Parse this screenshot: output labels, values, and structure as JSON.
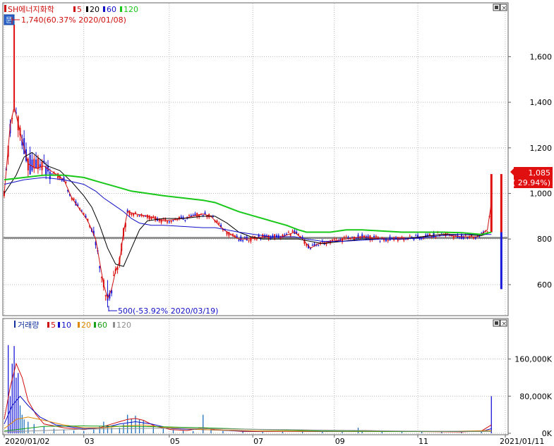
{
  "chart_data": [
    {
      "type": "candlestick",
      "panel": "price",
      "title": "SH에너지화학",
      "legend": [
        {
          "label": "SH에너지화학",
          "color": "#d01010"
        },
        {
          "label": "5",
          "color": "#d01010"
        },
        {
          "label": "20",
          "color": "#000000"
        },
        {
          "label": "60",
          "color": "#1010c8"
        },
        {
          "label": "120",
          "color": "#18c818"
        }
      ],
      "y_ticks": [
        "1,600",
        "1,400",
        "1,200",
        "1,000",
        "800",
        "600"
      ],
      "y_tick_values": [
        1600,
        1400,
        1200,
        1000,
        800,
        600
      ],
      "ylim": [
        470,
        1830
      ],
      "reference_line": 805,
      "last_price": {
        "value": "1,085",
        "change": "( 29.94%)"
      },
      "annotation_high": "1,740(60.37% 2020/01/08)",
      "annotation_low": "500(-53.92% 2020/03/19)",
      "ma_points": {
        "ma5": [
          [
            0,
            1000
          ],
          [
            3,
            1300
          ],
          [
            5,
            1380
          ],
          [
            8,
            1270
          ],
          [
            12,
            1130
          ],
          [
            16,
            1110
          ],
          [
            20,
            1120
          ],
          [
            25,
            1090
          ],
          [
            30,
            1060
          ],
          [
            34,
            980
          ],
          [
            38,
            930
          ],
          [
            42,
            880
          ],
          [
            46,
            800
          ],
          [
            48,
            700
          ],
          [
            50,
            600
          ],
          [
            52,
            540
          ],
          [
            54,
            580
          ],
          [
            56,
            660
          ],
          [
            58,
            700
          ],
          [
            60,
            830
          ],
          [
            62,
            920
          ],
          [
            66,
            910
          ],
          [
            72,
            900
          ],
          [
            80,
            880
          ],
          [
            90,
            890
          ],
          [
            100,
            910
          ],
          [
            104,
            900
          ],
          [
            108,
            860
          ],
          [
            112,
            830
          ],
          [
            118,
            800
          ],
          [
            124,
            800
          ],
          [
            130,
            810
          ],
          [
            140,
            810
          ],
          [
            146,
            830
          ],
          [
            150,
            800
          ],
          [
            154,
            760
          ],
          [
            158,
            780
          ],
          [
            165,
            790
          ],
          [
            172,
            800
          ],
          [
            180,
            810
          ],
          [
            190,
            800
          ],
          [
            200,
            800
          ],
          [
            210,
            810
          ],
          [
            220,
            820
          ],
          [
            230,
            810
          ],
          [
            238,
            810
          ],
          [
            243,
            840
          ],
          [
            245,
            960
          ]
        ],
        "ma20": [
          [
            0,
            1000
          ],
          [
            6,
            1080
          ],
          [
            10,
            1160
          ],
          [
            14,
            1180
          ],
          [
            18,
            1150
          ],
          [
            22,
            1120
          ],
          [
            28,
            1100
          ],
          [
            34,
            1050
          ],
          [
            40,
            990
          ],
          [
            44,
            940
          ],
          [
            48,
            860
          ],
          [
            52,
            760
          ],
          [
            56,
            690
          ],
          [
            60,
            680
          ],
          [
            64,
            760
          ],
          [
            68,
            840
          ],
          [
            72,
            880
          ],
          [
            80,
            890
          ],
          [
            90,
            890
          ],
          [
            100,
            900
          ],
          [
            106,
            900
          ],
          [
            112,
            870
          ],
          [
            118,
            830
          ],
          [
            124,
            810
          ],
          [
            130,
            800
          ],
          [
            140,
            800
          ],
          [
            148,
            800
          ],
          [
            154,
            790
          ],
          [
            160,
            780
          ],
          [
            170,
            790
          ],
          [
            180,
            800
          ],
          [
            190,
            800
          ],
          [
            200,
            800
          ],
          [
            210,
            810
          ],
          [
            220,
            820
          ],
          [
            230,
            820
          ],
          [
            240,
            815
          ],
          [
            245,
            830
          ]
        ],
        "ma60": [
          [
            0,
            1040
          ],
          [
            10,
            1060
          ],
          [
            20,
            1070
          ],
          [
            30,
            1060
          ],
          [
            40,
            1040
          ],
          [
            46,
            1010
          ],
          [
            50,
            980
          ],
          [
            55,
            950
          ],
          [
            60,
            920
          ],
          [
            64,
            890
          ],
          [
            68,
            870
          ],
          [
            74,
            860
          ],
          [
            80,
            860
          ],
          [
            90,
            855
          ],
          [
            100,
            850
          ],
          [
            106,
            850
          ],
          [
            112,
            840
          ],
          [
            118,
            830
          ],
          [
            126,
            820
          ],
          [
            134,
            810
          ],
          [
            146,
            810
          ],
          [
            152,
            800
          ],
          [
            160,
            790
          ],
          [
            170,
            790
          ],
          [
            180,
            795
          ],
          [
            190,
            800
          ],
          [
            200,
            800
          ],
          [
            210,
            805
          ],
          [
            220,
            815
          ],
          [
            230,
            820
          ],
          [
            240,
            820
          ],
          [
            245,
            820
          ]
        ],
        "ma120": [
          [
            0,
            1060
          ],
          [
            10,
            1070
          ],
          [
            20,
            1080
          ],
          [
            30,
            1080
          ],
          [
            40,
            1070
          ],
          [
            48,
            1050
          ],
          [
            56,
            1030
          ],
          [
            64,
            1010
          ],
          [
            72,
            1000
          ],
          [
            80,
            990
          ],
          [
            90,
            980
          ],
          [
            100,
            970
          ],
          [
            106,
            960
          ],
          [
            112,
            940
          ],
          [
            118,
            920
          ],
          [
            126,
            900
          ],
          [
            134,
            880
          ],
          [
            142,
            860
          ],
          [
            148,
            840
          ],
          [
            152,
            830
          ],
          [
            158,
            830
          ],
          [
            164,
            830
          ],
          [
            172,
            840
          ],
          [
            180,
            840
          ],
          [
            190,
            835
          ],
          [
            200,
            830
          ],
          [
            210,
            830
          ],
          [
            220,
            830
          ],
          [
            230,
            828
          ],
          [
            240,
            820
          ],
          [
            245,
            830
          ]
        ]
      }
    },
    {
      "type": "bar",
      "panel": "volume",
      "title": "거래량",
      "legend": [
        {
          "label": "거래량",
          "color": "#1030a0"
        },
        {
          "label": "5",
          "color": "#d01010"
        },
        {
          "label": "10",
          "color": "#1010c8"
        },
        {
          "label": "20",
          "color": "#e08800"
        },
        {
          "label": "60",
          "color": "#18a018"
        },
        {
          "label": "120",
          "color": "#909090"
        }
      ],
      "y_ticks": [
        "160,000K",
        "80,000K",
        "0K"
      ],
      "y_tick_values": [
        160000,
        80000,
        0
      ],
      "ylim": [
        0,
        220000
      ],
      "x_labels": [
        "2020/01/02",
        "03",
        "05",
        "07",
        "09",
        "11",
        "2021/01/11"
      ],
      "x_label_positions_idx": [
        0,
        40,
        83,
        125,
        166,
        208,
        252
      ],
      "volumes": [
        [
          2,
          190000
        ],
        [
          3,
          80000
        ],
        [
          4,
          150000
        ],
        [
          5,
          188000
        ],
        [
          6,
          120000
        ],
        [
          7,
          130000
        ],
        [
          8,
          60000
        ],
        [
          9,
          40000
        ],
        [
          10,
          30000
        ],
        [
          12,
          25000
        ],
        [
          15,
          20000
        ],
        [
          20,
          15000
        ],
        [
          25,
          10000
        ],
        [
          30,
          8000
        ],
        [
          35,
          6000
        ],
        [
          40,
          5000
        ],
        [
          45,
          8000
        ],
        [
          48,
          15000
        ],
        [
          50,
          25000
        ],
        [
          52,
          18000
        ],
        [
          54,
          12000
        ],
        [
          58,
          12000
        ],
        [
          60,
          20000
        ],
        [
          62,
          40000
        ],
        [
          64,
          32000
        ],
        [
          66,
          38000
        ],
        [
          68,
          30000
        ],
        [
          70,
          28000
        ],
        [
          75,
          15000
        ],
        [
          80,
          10000
        ],
        [
          85,
          8000
        ],
        [
          90,
          6000
        ],
        [
          95,
          5000
        ],
        [
          100,
          40000
        ],
        [
          104,
          8000
        ],
        [
          110,
          5000
        ],
        [
          120,
          4000
        ],
        [
          130,
          3000
        ],
        [
          140,
          4000
        ],
        [
          150,
          3000
        ],
        [
          160,
          3000
        ],
        [
          170,
          4000
        ],
        [
          178,
          12000
        ],
        [
          180,
          5000
        ],
        [
          190,
          4000
        ],
        [
          200,
          5000
        ],
        [
          210,
          4000
        ],
        [
          220,
          3000
        ],
        [
          230,
          3000
        ],
        [
          240,
          4000
        ],
        [
          245,
          80000
        ]
      ],
      "ma_points": {
        "ma5": [
          [
            0,
            30000
          ],
          [
            3,
            100000
          ],
          [
            6,
            150000
          ],
          [
            9,
            120000
          ],
          [
            12,
            70000
          ],
          [
            16,
            40000
          ],
          [
            20,
            20000
          ],
          [
            30,
            12000
          ],
          [
            40,
            8000
          ],
          [
            48,
            12000
          ],
          [
            54,
            20000
          ],
          [
            58,
            25000
          ],
          [
            62,
            30000
          ],
          [
            66,
            32000
          ],
          [
            70,
            28000
          ],
          [
            76,
            15000
          ],
          [
            84,
            8000
          ],
          [
            92,
            6000
          ],
          [
            100,
            12000
          ],
          [
            106,
            8000
          ],
          [
            120,
            4000
          ],
          [
            140,
            4000
          ],
          [
            170,
            4000
          ],
          [
            180,
            6000
          ],
          [
            200,
            4000
          ],
          [
            230,
            3000
          ],
          [
            240,
            5000
          ],
          [
            245,
            18000
          ]
        ],
        "ma10": [
          [
            0,
            20000
          ],
          [
            4,
            60000
          ],
          [
            8,
            80000
          ],
          [
            12,
            60000
          ],
          [
            18,
            35000
          ],
          [
            26,
            18000
          ],
          [
            40,
            10000
          ],
          [
            50,
            12000
          ],
          [
            58,
            20000
          ],
          [
            66,
            25000
          ],
          [
            74,
            20000
          ],
          [
            84,
            10000
          ],
          [
            100,
            8000
          ],
          [
            120,
            5000
          ],
          [
            160,
            4000
          ],
          [
            200,
            4000
          ],
          [
            240,
            4000
          ],
          [
            245,
            10000
          ]
        ],
        "ma20": [
          [
            0,
            10000
          ],
          [
            6,
            30000
          ],
          [
            12,
            35000
          ],
          [
            20,
            28000
          ],
          [
            30,
            18000
          ],
          [
            40,
            12000
          ],
          [
            50,
            12000
          ],
          [
            60,
            16000
          ],
          [
            70,
            18000
          ],
          [
            80,
            13000
          ],
          [
            100,
            8000
          ],
          [
            130,
            5000
          ],
          [
            180,
            4000
          ],
          [
            220,
            4000
          ],
          [
            245,
            6000
          ]
        ],
        "ma60": [
          [
            0,
            5000
          ],
          [
            20,
            15000
          ],
          [
            40,
            16000
          ],
          [
            60,
            15000
          ],
          [
            80,
            14000
          ],
          [
            100,
            12000
          ],
          [
            130,
            8000
          ],
          [
            160,
            5000
          ],
          [
            200,
            4000
          ],
          [
            245,
            4000
          ]
        ],
        "ma120": [
          [
            0,
            3000
          ],
          [
            40,
            9000
          ],
          [
            80,
            11000
          ],
          [
            120,
            9000
          ],
          [
            160,
            7000
          ],
          [
            200,
            5000
          ],
          [
            245,
            4000
          ]
        ]
      }
    }
  ]
}
